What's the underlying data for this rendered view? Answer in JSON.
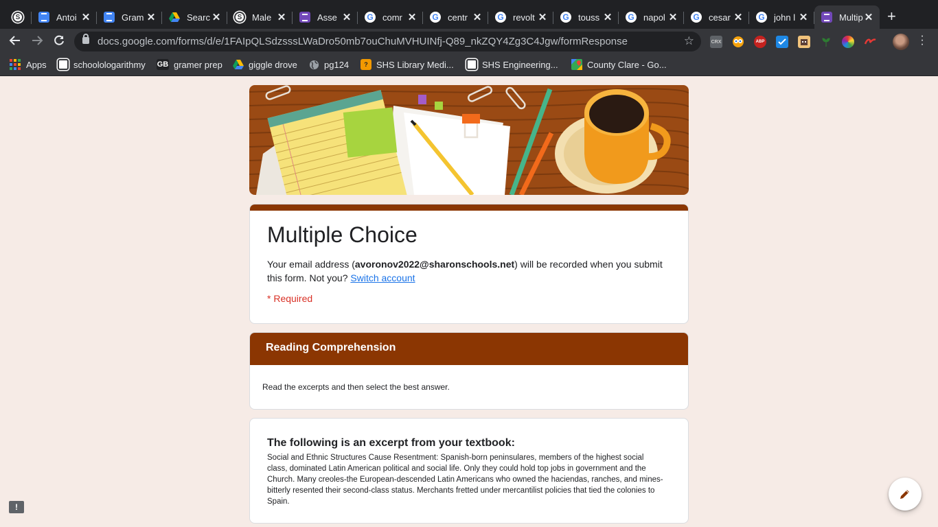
{
  "browser": {
    "tabs": [
      {
        "title": "Antoi",
        "icon": "schoology-icon"
      },
      {
        "title": "Gram",
        "icon": "docs-icon"
      },
      {
        "title": "Gram",
        "icon": "docs-icon"
      },
      {
        "title": "Searc",
        "icon": "drive-icon"
      },
      {
        "title": "Male",
        "icon": "schoology-icon"
      },
      {
        "title": "Asse",
        "icon": "forms-icon"
      },
      {
        "title": "comr",
        "icon": "google-icon"
      },
      {
        "title": "centr",
        "icon": "google-icon"
      },
      {
        "title": "revolt",
        "icon": "google-icon"
      },
      {
        "title": "touss",
        "icon": "google-icon"
      },
      {
        "title": "napol",
        "icon": "google-icon"
      },
      {
        "title": "cesar",
        "icon": "google-icon"
      },
      {
        "title": "john l",
        "icon": "google-icon"
      },
      {
        "title": "Multip",
        "icon": "forms-icon",
        "active": true
      }
    ],
    "url": "docs.google.com/forms/d/e/1FAIpQLSdzsssLWaDro50mb7ouChuMVHUINfj-Q89_nkZQY4Zg3C4Jgw/formResponse",
    "extensions": [
      "CRX",
      "ABP"
    ],
    "bookmarks": [
      {
        "label": "Apps",
        "icon": "apps-grid-icon"
      },
      {
        "label": "schoolologarithmy",
        "icon": "schoology-icon"
      },
      {
        "label": "gramer prep",
        "icon": "gb-icon"
      },
      {
        "label": "giggle drove",
        "icon": "drive-icon"
      },
      {
        "label": "pg124",
        "icon": "globe-icon"
      },
      {
        "label": "SHS Library Medi...",
        "icon": "library-icon"
      },
      {
        "label": "SHS Engineering...",
        "icon": "schoology-icon"
      },
      {
        "label": "County Clare - Go...",
        "icon": "maps-icon"
      }
    ]
  },
  "form": {
    "title": "Multiple Choice",
    "email_prefix": "Your email address (",
    "email": "avoronov2022@sharonschools.net",
    "email_suffix": ") will be recorded when you submit this form. Not you? ",
    "switch_account": "Switch account",
    "required": "* Required",
    "theme_color": "#8b3602",
    "background_color": "#f6ebe6",
    "section": {
      "title": "Reading Comprehension",
      "description": "Read the excerpts and then select the best answer."
    },
    "excerpt": {
      "title": "The following is an excerpt from your textbook:",
      "body": "Social and Ethnic Structures Cause Resentment: Spanish-born peninsulares, members of the highest social class, dominated Latin American political and social life. Only they could hold top jobs in government and the Church. Many creoles-the European-descended Latin Americans who owned the haciendas, ranches, and mines-bitterly resented their second-class status. Merchants fretted under mercantilist policies that tied the colonies to Spain."
    },
    "fab_icon": "pencil-icon",
    "report_icon": "report-issue-icon"
  }
}
